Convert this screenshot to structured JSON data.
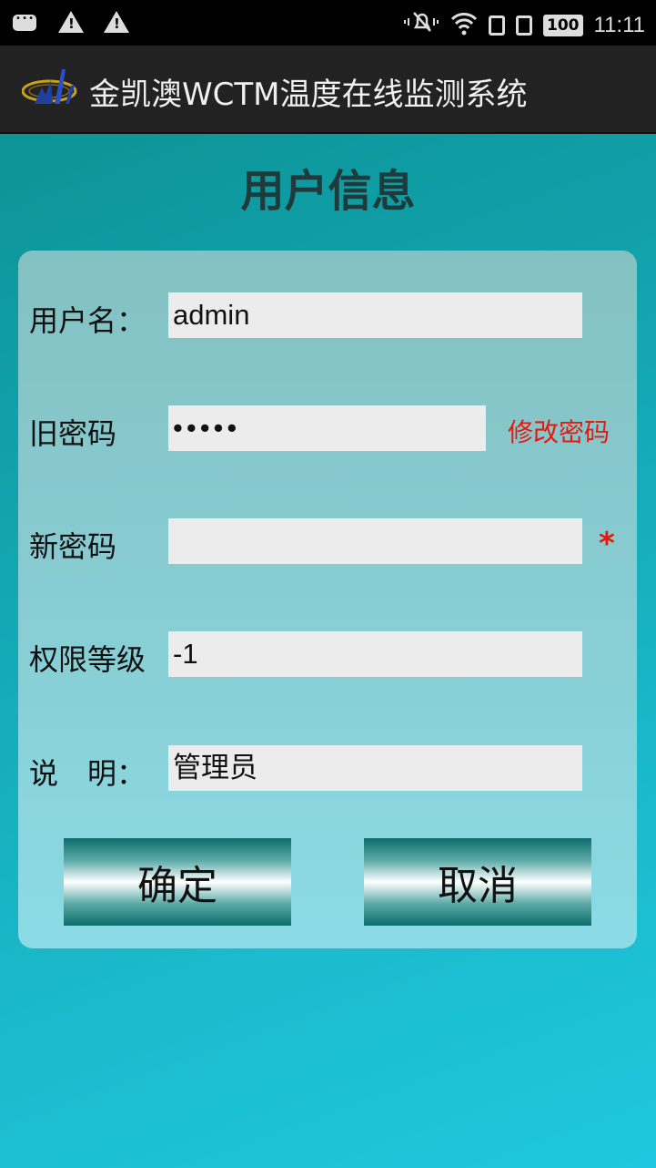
{
  "status_bar": {
    "time": "11:11",
    "battery": "100",
    "icons": [
      "message-icon",
      "warning-icon",
      "warning-icon",
      "mute-icon",
      "wifi-icon",
      "sim-card-icon",
      "sim-card-icon",
      "battery-icon"
    ]
  },
  "app_bar": {
    "title": "金凯澳WCTM温度在线监测系统",
    "logo_icon": "app-logo-icon"
  },
  "page": {
    "title": "用户信息"
  },
  "form": {
    "username_label": "用户名：",
    "username_value": "admin",
    "old_password_label": "旧密码",
    "old_password_value": "•••••",
    "change_password_link": "修改密码",
    "new_password_label": "新密码",
    "new_password_value": "",
    "required_mark": "*",
    "permission_label": "权限等级",
    "permission_value": "-1",
    "description_label": "说　明：",
    "description_value": "管理员"
  },
  "buttons": {
    "confirm": "确定",
    "cancel": "取消"
  },
  "colors": {
    "accent_red": "#e8180f",
    "app_bar": "#222222",
    "page_title": "#1f3a3a"
  }
}
